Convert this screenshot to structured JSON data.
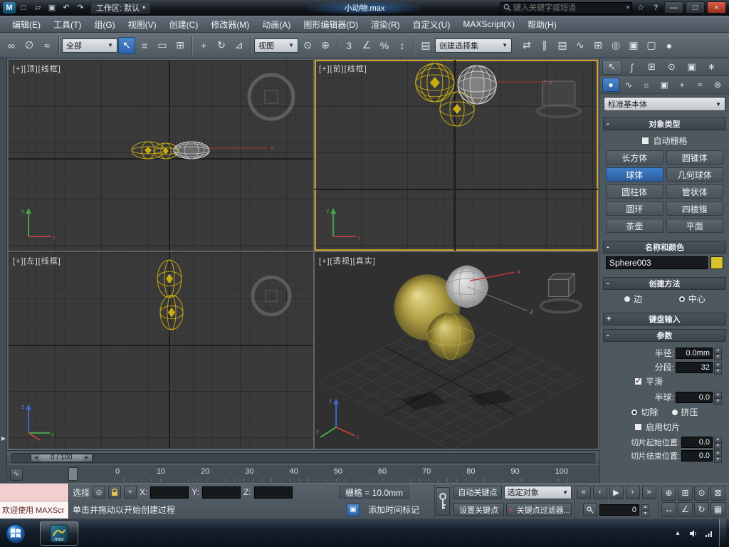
{
  "titlebar": {
    "workspace": "工作区: 默认",
    "title": "小动物.max",
    "search_placeholder": "键入关键字或短语"
  },
  "menus": [
    "编辑(E)",
    "工具(T)",
    "组(G)",
    "视图(V)",
    "创建(C)",
    "修改器(M)",
    "动画(A)",
    "图形编辑器(D)",
    "渲染(R)",
    "自定义(U)",
    "MAXScript(X)",
    "帮助(H)"
  ],
  "toolbar": {
    "filter": "全部",
    "view": "视图",
    "selection_set": "创建选择集"
  },
  "viewports": {
    "top_left": "[+][顶][线框]",
    "top_right": "[+][前][线框]",
    "bottom_left": "[+][左][线框]",
    "perspective": "[+][透视][真实]"
  },
  "panel": {
    "category": "标准基本体",
    "object_type": {
      "title": "对象类型",
      "autogrid": "自动栅格",
      "buttons": [
        "长方体",
        "圆锥体",
        "球体",
        "几何球体",
        "圆柱体",
        "管状体",
        "圆环",
        "四棱锥",
        "茶壶",
        "平面"
      ]
    },
    "name_color": {
      "title": "名称和颜色",
      "name": "Sphere003",
      "color_hex": "#d8c32e"
    },
    "creation_method": {
      "title": "创建方法",
      "edge": "边",
      "center": "中心"
    },
    "keyboard_entry": {
      "title": "键盘输入"
    },
    "parameters": {
      "title": "参数",
      "radius": "半径:",
      "radius_v": "0.0mm",
      "segs": "分段:",
      "segs_v": "32",
      "smooth": "平滑",
      "hemi": "半球:",
      "hemi_v": "0.0",
      "chop": "切除",
      "squash": "挤压",
      "slice_on": "启用切片",
      "slice_from": "切片起始位置:",
      "slice_from_v": "0.0",
      "slice_to": "切片结束位置:",
      "slice_to_v": "0.0"
    }
  },
  "timeline": {
    "thumb": "0 / 100"
  },
  "trackbar": {
    "ticks": [
      "0",
      "10",
      "20",
      "30",
      "40",
      "50",
      "60",
      "70",
      "80",
      "90",
      "100"
    ]
  },
  "status": {
    "select": "选择",
    "x": "X:",
    "y": "Y:",
    "z": "Z:",
    "grid": "栅格 = 10.0mm",
    "welcome": "欢迎使用 MAXScr",
    "prompt": "单击并拖动以开始创建过程",
    "time_tag": "添加时间标记",
    "auto_key": "自动关键点",
    "set_key": "设置关键点",
    "sel_obj": "选定对象",
    "key_filters": "关键点过滤器...",
    "frame": "0"
  },
  "taskbar": {
    "app": "max"
  },
  "colors": {
    "accent_blue": "#3a76c4",
    "active_viewport_border": "#c9a227",
    "object_yellow": "#c2a512",
    "selection_white": "#e8e8e8"
  },
  "icons": {
    "new": "□",
    "open": "▱",
    "save": "▣",
    "undo": "↶",
    "redo": "↷",
    "dd": "▾",
    "favorites": "☆",
    "help": "?",
    "min": "—",
    "max": "□",
    "close": "×",
    "link": "∞",
    "unlink": "∅",
    "bind": "≈",
    "select": "↖",
    "byname": "≡",
    "rect": "▭",
    "wincross": "⊞",
    "move": "+",
    "rotate": "↻",
    "scale": "⊿",
    "pivot": "⊙",
    "manip": "⊕",
    "snap3": "3",
    "angle": "∠",
    "percent": "%",
    "spinner": "↕",
    "sets": "▤",
    "mirror": "⇄",
    "align": "∥",
    "layers": "▤",
    "curve": "∿",
    "schematic": "⊞",
    "material": "◎",
    "rendersetup": "▣",
    "renderframe": "▢",
    "render": "●",
    "tab_create": "↖",
    "tab_modify": "∫",
    "tab_hier": "⊞",
    "tab_motion": "⊙",
    "tab_display": "▣",
    "tab_utils": "∗",
    "cat_geom": "●",
    "cat_shapes": "∿",
    "cat_lights": "☼",
    "cat_cameras": "▣",
    "cat_helpers": "+",
    "cat_space": "≈",
    "cat_systems": "⊛",
    "minus": "-",
    "plus": "+",
    "down": "▼",
    "spin_up": "▴",
    "spin_down": "▾",
    "goto_start": "«",
    "prev": "‹",
    "play": "▶",
    "next": "›",
    "goto_end": "»",
    "nav_zoom": "⊕",
    "nav_zoomall": "⊞",
    "nav_extents": "⊙",
    "nav_region": "⊠",
    "nav_pan": "↔",
    "nav_fov": "∠",
    "nav_orbit": "↻",
    "nav_max": "▦",
    "mini_curve": "∿",
    "thumb_left": "◀",
    "thumb_right": "▶",
    "tray_chevron": "▴",
    "isolate": "⊙",
    "xform": "+",
    "progressive": "▣",
    "left_flyout": "▶",
    "keyfilter_curve": "∿"
  }
}
